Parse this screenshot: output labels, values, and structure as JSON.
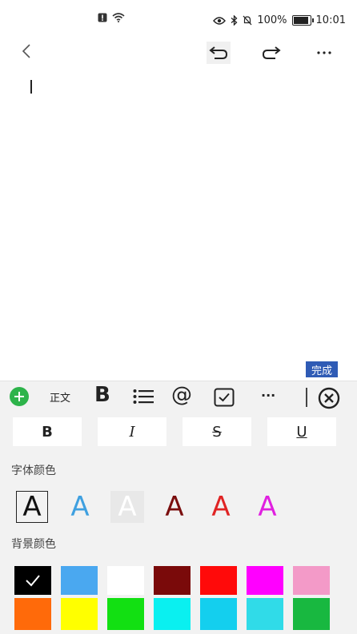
{
  "status_bar": {
    "battery": "100%",
    "time": "10:01"
  },
  "editor": {
    "done_label": "完成"
  },
  "format_toolbar": {
    "paragraph_style": "正文",
    "bold_glyph": "B",
    "mention_glyph": "@",
    "more_glyph": "···"
  },
  "text_styles": {
    "bold": "B",
    "italic": "I",
    "strike": "S",
    "underline": "U"
  },
  "font_color": {
    "label": "字体颜色",
    "sample": "A",
    "colors": [
      "#111111",
      "#3fa0e0",
      "#e6e6e6",
      "#7a0e0e",
      "#e02424",
      "#e020e0"
    ]
  },
  "background_color": {
    "label": "背景颜色",
    "colors_row1": [
      "#000000",
      "#4aa8f0",
      "#ffffff",
      "#7a0a0a",
      "#ff0a0a",
      "#ff00ff",
      "#f39ac8"
    ],
    "colors_row2": [
      "#ff6a0a",
      "#ffff00",
      "#12e012",
      "#0af0f0",
      "#14cfee",
      "#30dbe8",
      "#18b840"
    ]
  }
}
